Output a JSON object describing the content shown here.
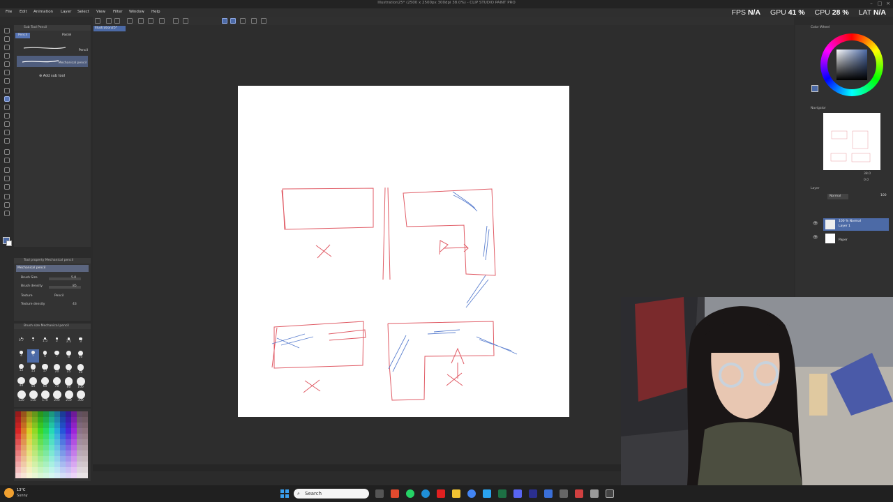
{
  "window": {
    "title": "Illustration25* (2500 x 2500px 300dpi 38.0%) - CLIP STUDIO PAINT PRO"
  },
  "menu": [
    "File",
    "Edit",
    "Animation",
    "Layer",
    "Select",
    "View",
    "Filter",
    "Window",
    "Help"
  ],
  "stats": {
    "fps_label": "FPS",
    "fps_value": "N/A",
    "gpu_label": "GPU",
    "gpu_value": "41 %",
    "cpu_label": "CPU",
    "cpu_value": "28 %",
    "lat_label": "LAT",
    "lat_value": "N/A"
  },
  "canvas_tab": "Illustration25*",
  "subtool": {
    "header": "Sub Tool Pencil",
    "tabs": [
      "Pencil",
      "Pastel"
    ],
    "group_label": "Pencil",
    "active_brush": "Mechanical pencil",
    "add_label": "Add sub tool"
  },
  "tool_property": {
    "header": "Tool property Mechanical pencil",
    "brush_name": "Mechanical pencil",
    "rows": [
      {
        "label": "Brush Size",
        "value": "5.0"
      },
      {
        "label": "Brush density",
        "value": "85"
      },
      {
        "label": "Texture",
        "value": "Pencil"
      },
      {
        "label": "Texture density",
        "value": "43"
      }
    ]
  },
  "brush_size_panel": {
    "header": "Brush size Mechanical pencil",
    "sizes": [
      "0.7",
      "1",
      "1.5",
      "2",
      "2.5",
      "3",
      "4",
      "5",
      "6",
      "7",
      "8",
      "10",
      "12",
      "15",
      "17",
      "20",
      "25",
      "30",
      "40",
      "50",
      "60",
      "70",
      "80",
      "100",
      "120",
      "150",
      "170",
      "200",
      "250",
      "300"
    ]
  },
  "right_panel": {
    "color_wheel_label": "Color Wheel",
    "navigator_label": "Navigator",
    "layer_label": "Layer",
    "blend_mode": "Normal",
    "opacity": "100",
    "layers": [
      {
        "name": "100 % Normal",
        "sub": "Layer 1",
        "selected": true
      },
      {
        "name": "Paper",
        "sub": "",
        "selected": false
      }
    ],
    "zoom": "38.0",
    "rotation": "0.0"
  },
  "taskbar": {
    "weather_temp": "13°C",
    "weather_desc": "Sunny",
    "search_placeholder": "Search"
  },
  "colors": {
    "accent": "#4c6aa6",
    "sketch_red": "#e05a64",
    "sketch_blue": "#5b7fcf"
  }
}
